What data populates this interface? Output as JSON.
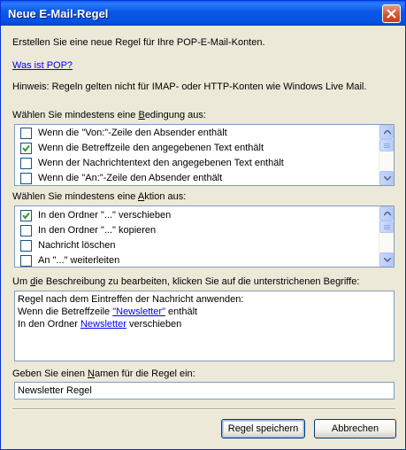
{
  "window": {
    "title": "Neue E-Mail-Regel"
  },
  "intro": "Erstellen Sie eine neue Regel für Ihre POP-E-Mail-Konten.",
  "pop_link": "Was ist POP?",
  "hint": "Hinweis: Regeln gelten nicht für IMAP- oder HTTP-Konten wie Windows Live Mail.",
  "conditions": {
    "label_pre": "Wählen Sie mindestens eine ",
    "label_accel": "B",
    "label_post": "edingung aus:",
    "items": [
      {
        "label": "Wenn die \"Von:\"-Zeile den Absender enthält",
        "checked": false
      },
      {
        "label": "Wenn die Betreffzeile den angegebenen Text enthält",
        "checked": true
      },
      {
        "label": "Wenn der Nachrichtentext den angegebenen Text enthält",
        "checked": false
      },
      {
        "label": "Wenn die \"An:\"-Zeile den Absender enthält",
        "checked": false
      }
    ]
  },
  "actions": {
    "label_pre": "Wählen Sie mindestens eine ",
    "label_accel": "A",
    "label_post": "ktion aus:",
    "items": [
      {
        "label": "In den Ordner \"...\" verschieben",
        "checked": true
      },
      {
        "label": "In den Ordner \"...\" kopieren",
        "checked": false
      },
      {
        "label": "Nachricht löschen",
        "checked": false
      },
      {
        "label": "An \"...\" weiterleiten",
        "checked": false
      }
    ]
  },
  "description": {
    "label_pre": "Um ",
    "label_accel": "d",
    "label_post": "ie Beschreibung zu bearbeiten, klicken Sie auf die unterstrichenen Begriffe:",
    "line1": "Regel nach dem Eintreffen der Nachricht anwenden:",
    "line2_pre": "Wenn die Betreffzeile ",
    "line2_link": "\"Newsletter\"",
    "line2_post": " enthält",
    "line3_pre": "In den Ordner ",
    "line3_link": "Newsletter",
    "line3_post": " verschieben"
  },
  "name": {
    "label_pre": "Geben Sie einen ",
    "label_accel": "N",
    "label_post": "amen für die Regel ein:",
    "value": "Newsletter Regel"
  },
  "buttons": {
    "save": "Regel speichern",
    "cancel": "Abbrechen"
  }
}
